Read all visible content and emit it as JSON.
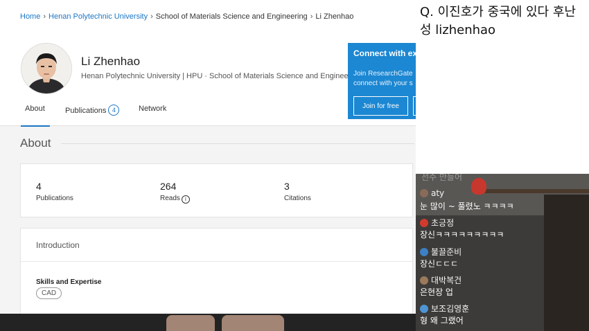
{
  "breadcrumb": {
    "items": [
      "Home",
      "Henan Polytechnic University",
      "School of Materials Science and Engineering",
      "Li Zhenhao"
    ]
  },
  "profile": {
    "name": "Li Zhenhao",
    "affiliation": "Henan Polytechnic University | HPU · School of Materials Science and Engineering"
  },
  "tabs": {
    "about": "About",
    "publications": "Publications",
    "publications_count": "4",
    "network": "Network"
  },
  "connect": {
    "title": "Connect with ex",
    "line1": "Join ResearchGate",
    "line2": "connect with your s",
    "join_label": "Join for free"
  },
  "about": {
    "title": "About",
    "stats": [
      {
        "value": "4",
        "label": "Publications"
      },
      {
        "value": "264",
        "label": "Reads"
      },
      {
        "value": "3",
        "label": "Citations"
      }
    ],
    "intro_label": "Introduction",
    "skills_title": "Skills and Expertise",
    "skills": [
      "CAD"
    ]
  },
  "question": {
    "text": "Q. 이진호가 중국에 있다 후난성 lizhenhao"
  },
  "chat": {
    "faded_top": "선수  만들어",
    "messages": [
      {
        "user": "aty",
        "text": "눈 많이 ~ 풀렸노 ㅋㅋㅋㅋ",
        "avatar_color": "#8a6b5a"
      },
      {
        "user": "초긍정",
        "text": "장신ㅋㅋㅋㅋㅋㅋㅋㅋㅋ",
        "avatar_color": "#d23a2e"
      },
      {
        "user": "불끌준비",
        "text": "장신ㄷㄷㄷ",
        "avatar_color": "#3b7fc4"
      },
      {
        "user": "대박복건",
        "text": "은현장 업",
        "avatar_color": "#9b7a5c"
      },
      {
        "user": "보조김영훈",
        "text": "형 왜 그랬어",
        "avatar_color": "#4f94d4"
      }
    ]
  },
  "colors": {
    "link": "#1b76c5",
    "connect_bg": "#1c87d2",
    "page_bg": "#f4f4f4",
    "chat_bg": "#3c3b39"
  }
}
